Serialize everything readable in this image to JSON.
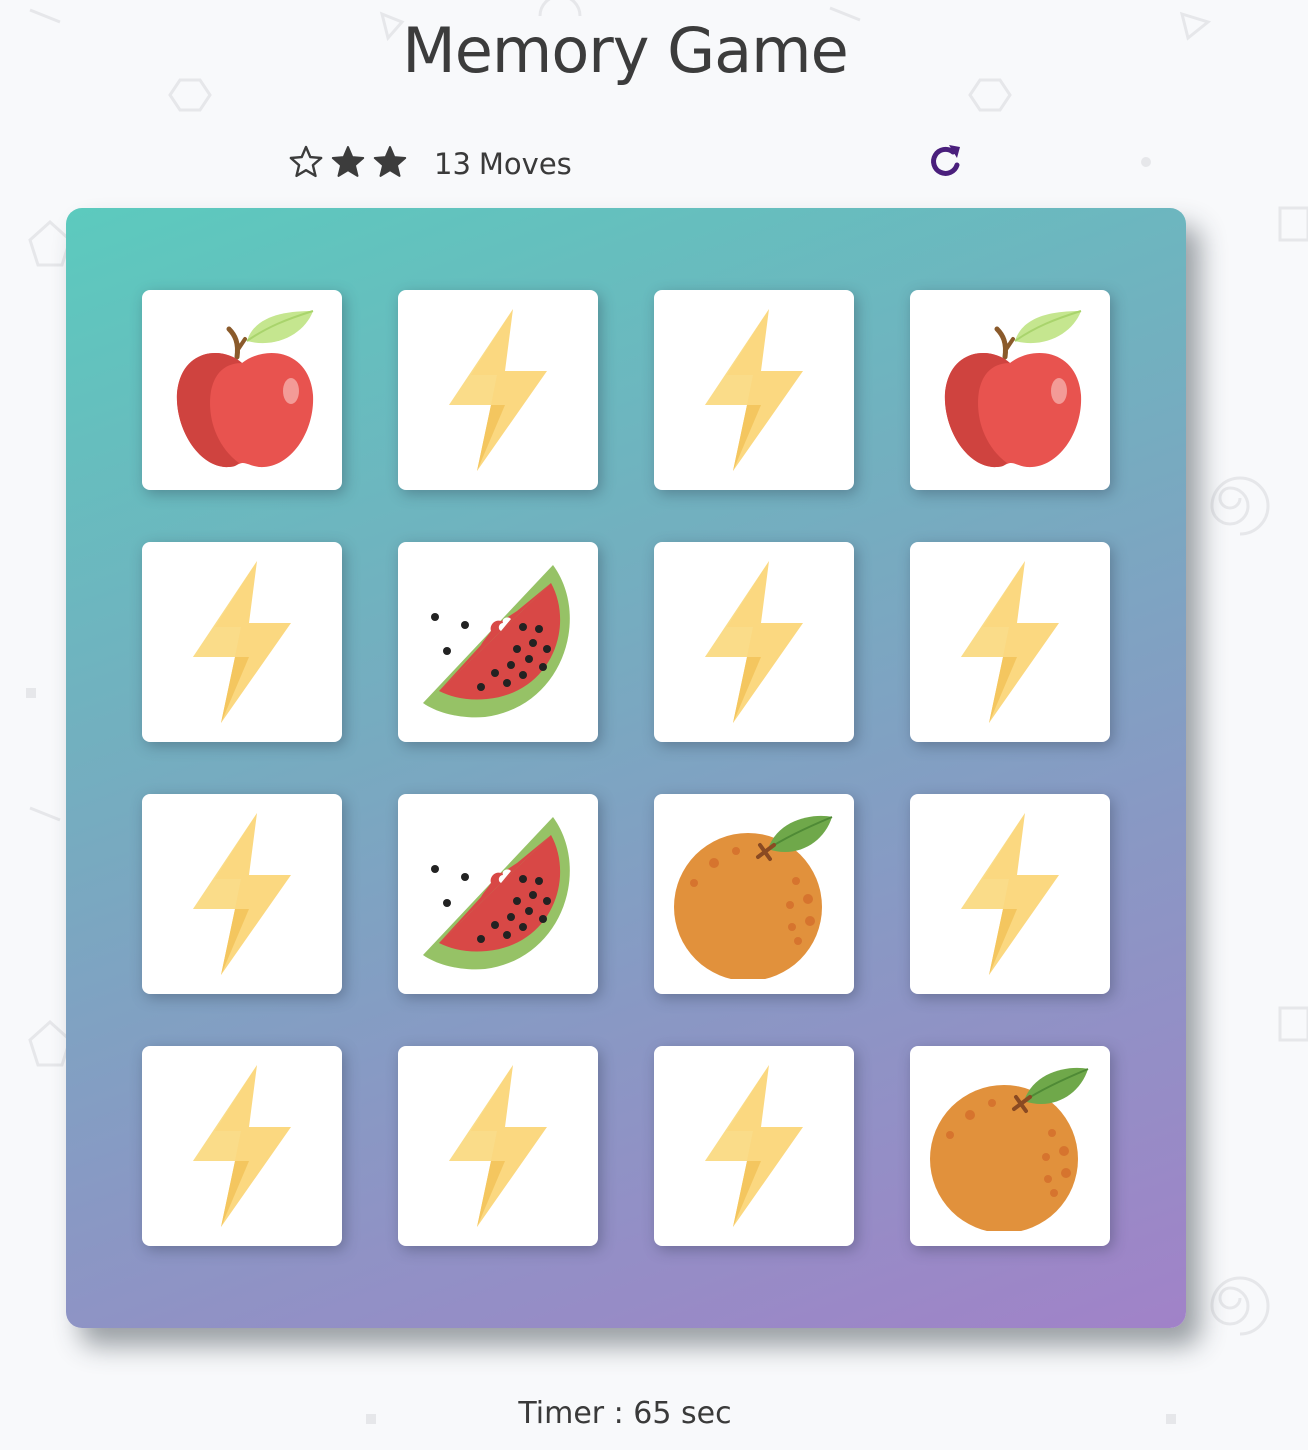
{
  "title": "Memory Game",
  "score_panel": {
    "stars": [
      {
        "state": "empty",
        "icon": "star-outline-icon"
      },
      {
        "state": "filled",
        "icon": "star-icon"
      },
      {
        "state": "filled",
        "icon": "star-icon"
      }
    ],
    "moves_count": "13",
    "moves_label": "Moves",
    "restart_icon": "restart-icon"
  },
  "deck": {
    "columns": 4,
    "rows": 4,
    "cards": [
      {
        "face": "apple",
        "state": "open"
      },
      {
        "face": "bolt",
        "state": "closed"
      },
      {
        "face": "bolt",
        "state": "closed"
      },
      {
        "face": "apple",
        "state": "open"
      },
      {
        "face": "bolt",
        "state": "closed"
      },
      {
        "face": "watermelon",
        "state": "open"
      },
      {
        "face": "bolt",
        "state": "closed"
      },
      {
        "face": "bolt",
        "state": "closed"
      },
      {
        "face": "bolt",
        "state": "closed"
      },
      {
        "face": "watermelon",
        "state": "open"
      },
      {
        "face": "orange",
        "state": "open"
      },
      {
        "face": "bolt",
        "state": "closed"
      },
      {
        "face": "bolt",
        "state": "closed"
      },
      {
        "face": "bolt",
        "state": "closed"
      },
      {
        "face": "bolt",
        "state": "closed"
      },
      {
        "face": "orange",
        "state": "open"
      }
    ]
  },
  "timer": {
    "text": "Timer : 65 sec"
  },
  "colors": {
    "deck_gradient_start": "#5ccabe",
    "deck_gradient_end": "#a182c8",
    "restart_color": "#4a1f7c",
    "text_color": "#3a3a3a"
  }
}
